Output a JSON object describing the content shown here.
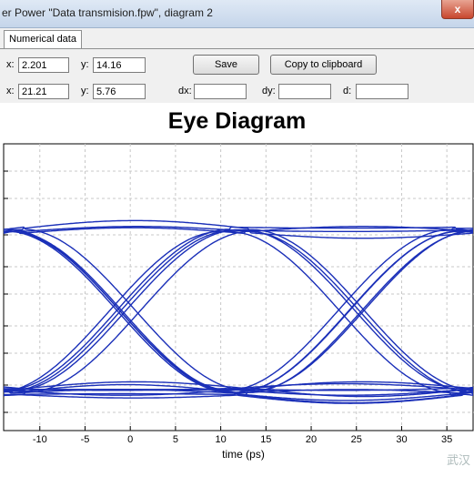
{
  "window": {
    "title": "er Power \"Data transmision.fpw\", diagram 2",
    "close_glyph": "x"
  },
  "tabs": [
    {
      "label": "Numerical data"
    }
  ],
  "cursor1": {
    "x_label": "x:",
    "x_value": "2.201",
    "y_label": "y:",
    "y_value": "14.16"
  },
  "cursor2": {
    "x_label": "x:",
    "x_value": "21.21",
    "y_label": "y:",
    "y_value": "5.76"
  },
  "deltas": {
    "dx_label": "dx:",
    "dx_value": "",
    "dy_label": "dy:",
    "dy_value": "",
    "d_label": "d:",
    "d_value": ""
  },
  "buttons": {
    "save": "Save",
    "copy": "Copy to clipboard"
  },
  "watermark": "武汉",
  "chart_data": {
    "type": "line",
    "title": "Eye Diagram",
    "xlabel": "time (ps)",
    "ylabel": "",
    "xlim": [
      -14,
      38
    ],
    "x_ticks": [
      "-10",
      "-5",
      "0",
      "5",
      "10",
      "15",
      "20",
      "25",
      "30",
      "35"
    ],
    "unit_interval_ps": 25,
    "grid": true,
    "line_color": "#1a2fb8",
    "description_levels": {
      "high_band": "upper rail",
      "low_band": "lower rail"
    }
  }
}
